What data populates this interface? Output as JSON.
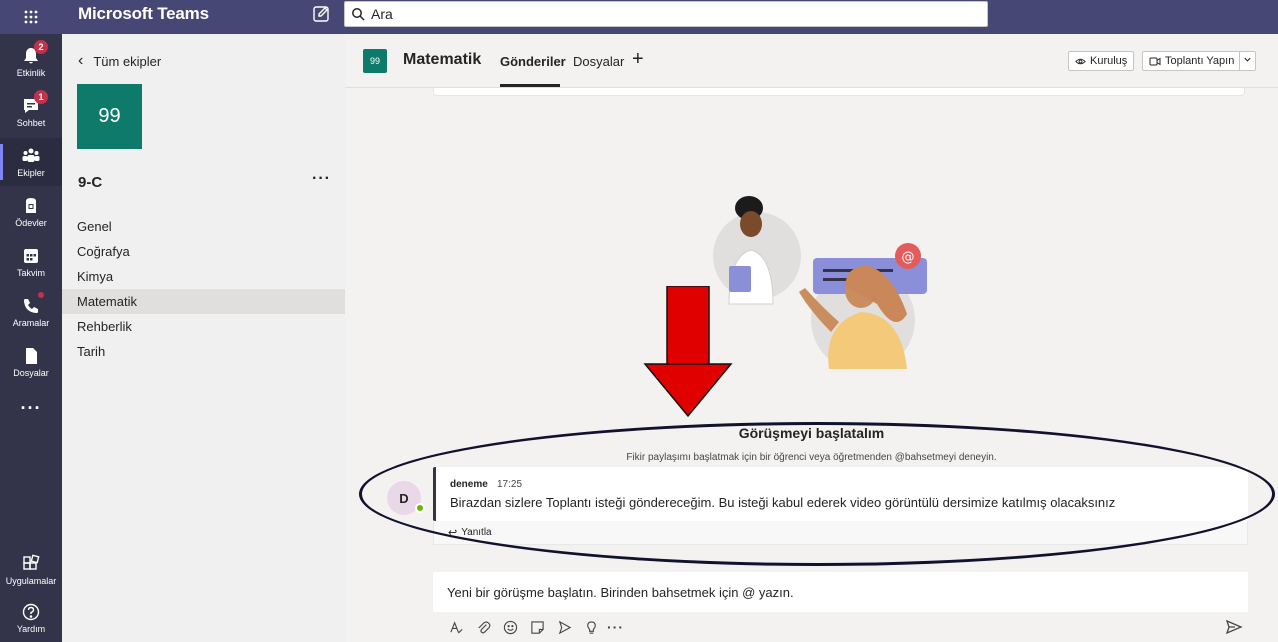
{
  "topbar": {
    "app_title": "Microsoft Teams",
    "search_placeholder": "Ara"
  },
  "rail": {
    "items": [
      {
        "label": "Etkinlik",
        "icon": "bell-icon",
        "badge": "2"
      },
      {
        "label": "Sohbet",
        "icon": "chat-icon",
        "badge": "1"
      },
      {
        "label": "Ekipler",
        "icon": "teams-icon"
      },
      {
        "label": "Ödevler",
        "icon": "assignments-icon"
      },
      {
        "label": "Takvim",
        "icon": "calendar-icon"
      },
      {
        "label": "Aramalar",
        "icon": "phone-icon"
      },
      {
        "label": "Dosyalar",
        "icon": "file-icon"
      },
      {
        "label": "···",
        "icon": "more-icon"
      },
      {
        "label": "Uygulamalar",
        "icon": "apps-icon"
      },
      {
        "label": "Yardım",
        "icon": "help-icon"
      }
    ]
  },
  "team_panel": {
    "back_label": "Tüm ekipler",
    "team_avatar": "99",
    "team_name": "9-C",
    "more": "···",
    "channels": [
      "Genel",
      "Coğrafya",
      "Kimya",
      "Matematik",
      "Rehberlik",
      "Tarih"
    ],
    "active_channel": "Matematik"
  },
  "header": {
    "channel_avatar": "99",
    "channel_title": "Matematik",
    "tabs": [
      "Gönderiler",
      "Dosyalar"
    ],
    "add_tab": "+",
    "org_button": "Kuruluş",
    "meet_button": "Toplantı Yapın",
    "dropdown": "⌄"
  },
  "conversation": {
    "title": "Görüşmeyi başlatalım",
    "subtitle": "Fikir paylaşımı başlatmak için bir öğrenci veya öğretmenden @bahsetmeyi deneyin."
  },
  "message": {
    "avatar_initial": "D",
    "author": "deneme",
    "time": "17:25",
    "body": "Birazdan sizlere Toplantı isteği göndereceğim. Bu isteği kabul ederek video görüntülü dersimize katılmış olacaksınız",
    "reply_label": "Yanıtla"
  },
  "composer": {
    "placeholder": "Yeni bir görüşme başlatın. Birinden bahsetmek için @ yazın.",
    "more": "···"
  },
  "colors": {
    "topbar": "#464775",
    "rail": "#33344a",
    "accent": "#0e7a6a",
    "arrow": "#e00000"
  }
}
